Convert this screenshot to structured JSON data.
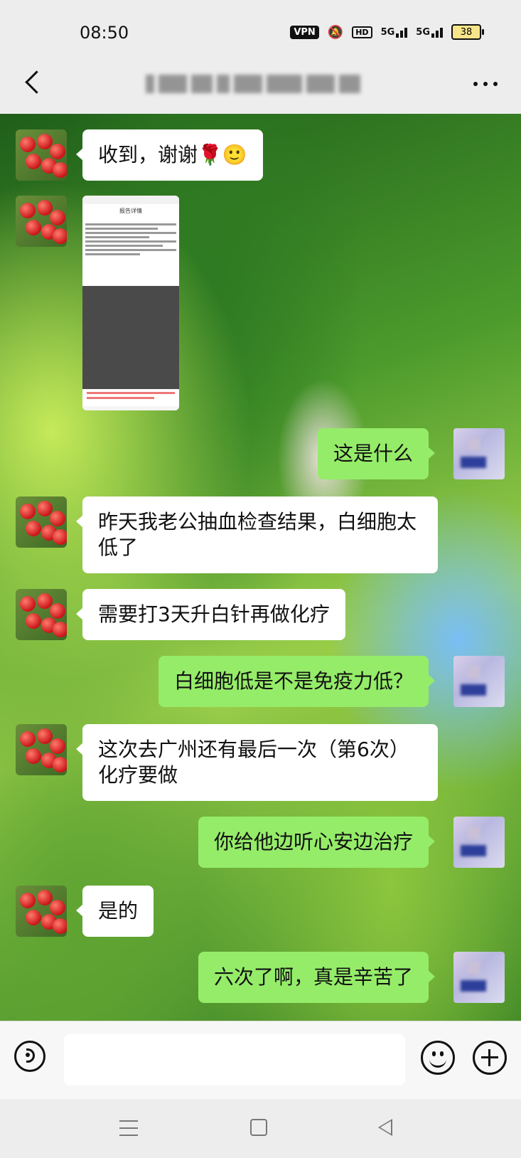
{
  "status_bar": {
    "time": "08:50",
    "vpn": "VPN",
    "hd": "HD",
    "signal1": "5G",
    "signal2": "5G",
    "battery": "38"
  },
  "header": {
    "title_obscured": true
  },
  "messages": [
    {
      "side": "left",
      "type": "text",
      "text": "收到，谢谢🌹🙂"
    },
    {
      "side": "left",
      "type": "image",
      "image_header": "报告详情"
    },
    {
      "side": "right",
      "type": "text",
      "text": "这是什么"
    },
    {
      "side": "left",
      "type": "text",
      "text": "昨天我老公抽血检查结果，白细胞太低了"
    },
    {
      "side": "left",
      "type": "text",
      "text": "需要打3天升白针再做化疗"
    },
    {
      "side": "right",
      "type": "text",
      "text": "白细胞低是不是免疫力低？"
    },
    {
      "side": "left",
      "type": "text",
      "text": "这次去广州还有最后一次（第6次）化疗要做"
    },
    {
      "side": "right",
      "type": "text",
      "text": "你给他边听心安边治疗"
    },
    {
      "side": "left",
      "type": "text",
      "text": "是的"
    },
    {
      "side": "right",
      "type": "text",
      "text": "六次了啊，真是辛苦了"
    }
  ],
  "input": {
    "placeholder": ""
  },
  "icons": {
    "back": "chevron-left-icon",
    "more": "more-icon",
    "voice": "voice-icon",
    "emoji": "emoji-icon",
    "plus": "plus-icon"
  }
}
